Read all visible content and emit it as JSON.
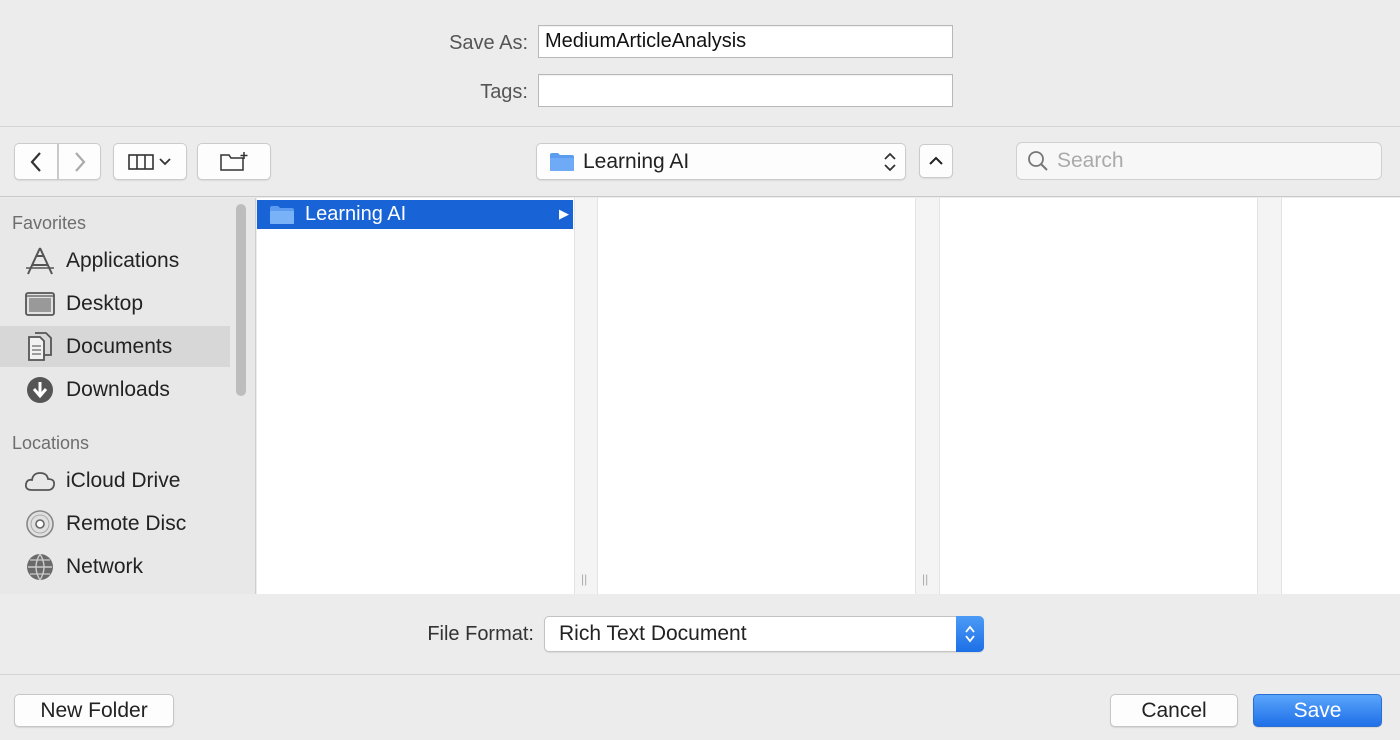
{
  "form": {
    "save_as_label": "Save As:",
    "save_as_value": "MediumArticleAnalysis",
    "tags_label": "Tags:",
    "tags_value": ""
  },
  "toolbar": {
    "current_folder": "Learning AI",
    "search_placeholder": "Search"
  },
  "sidebar": {
    "favorites_header": "Favorites",
    "favorites": [
      {
        "label": "Applications",
        "icon": "applications-icon"
      },
      {
        "label": "Desktop",
        "icon": "desktop-icon"
      },
      {
        "label": "Documents",
        "icon": "documents-icon",
        "selected": true
      },
      {
        "label": "Downloads",
        "icon": "downloads-icon"
      }
    ],
    "locations_header": "Locations",
    "locations": [
      {
        "label": "iCloud Drive",
        "icon": "cloud-icon"
      },
      {
        "label": "Remote Disc",
        "icon": "disc-icon"
      },
      {
        "label": "Network",
        "icon": "network-icon"
      }
    ]
  },
  "browser": {
    "items": [
      {
        "label": "Learning AI",
        "selected": true
      }
    ]
  },
  "format": {
    "label": "File Format:",
    "selected": "Rich Text Document"
  },
  "buttons": {
    "new_folder": "New Folder",
    "cancel": "Cancel",
    "save": "Save"
  },
  "colors": {
    "accent": "#1864d6",
    "folder": "#5b9cf0"
  }
}
